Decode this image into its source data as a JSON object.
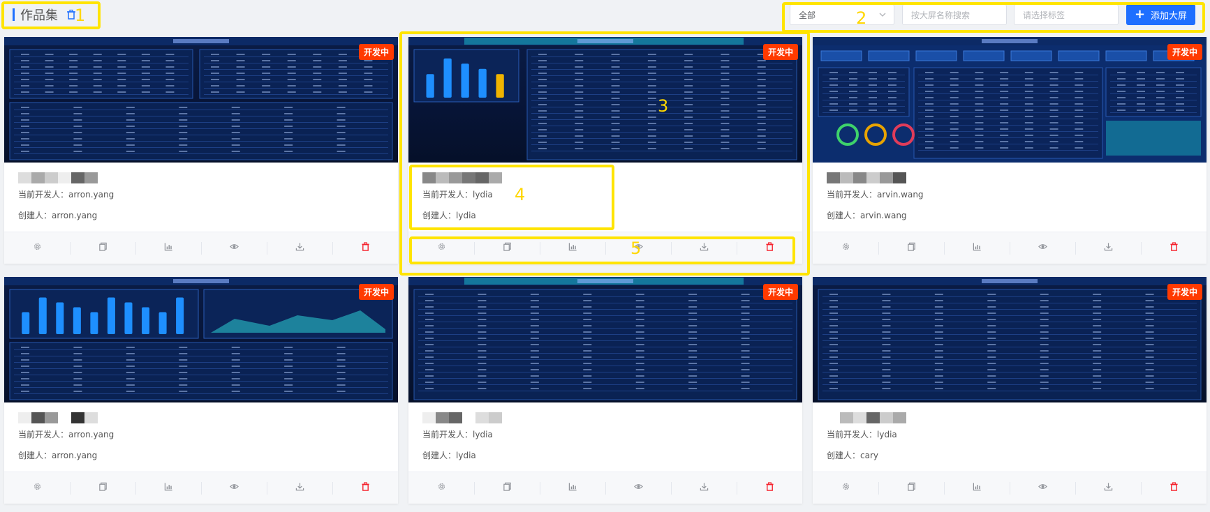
{
  "page": {
    "title": "作品集",
    "title_icon": "trash-icon"
  },
  "toolbar": {
    "category_select": "全部",
    "search_placeholder": "按大屏名称搜索",
    "tag_placeholder": "请选择标签",
    "add_label": "添加大屏",
    "accent_color": "#1e6fff"
  },
  "labels": {
    "developer_prefix": "当前开发人：",
    "creator_prefix": "创建人：",
    "status_badge": "开发中",
    "badge_color": "#ff3a00"
  },
  "cards": [
    {
      "preview_title": "知识库情况",
      "developer": "arron.yang",
      "creator": "arron.yang",
      "status": "开发中"
    },
    {
      "preview_title": "话务倒重复受理事件",
      "developer": "lydia",
      "creator": "lydia",
      "status": "开发中"
    },
    {
      "preview_title": "中国航油运维管理大屏",
      "developer": "arvin.wang",
      "creator": "arvin.wang",
      "status": "开发中"
    },
    {
      "preview_title": "受理情况",
      "developer": "arron.yang",
      "creator": "arron.yang",
      "status": "开发中"
    },
    {
      "preview_title": "重点关注事件",
      "developer": "lydia",
      "creator": "lydia",
      "status": "开发中"
    },
    {
      "preview_title": "升级信息",
      "developer": "lydia",
      "creator": "cary",
      "status": "开发中"
    }
  ],
  "card_actions": [
    {
      "name": "settings-button",
      "icon": "gear-icon"
    },
    {
      "name": "copy-button",
      "icon": "copy-icon"
    },
    {
      "name": "chart-button",
      "icon": "chart-icon"
    },
    {
      "name": "preview-button",
      "icon": "eye-icon"
    },
    {
      "name": "download-button",
      "icon": "download-icon"
    },
    {
      "name": "delete-button",
      "icon": "trash-icon"
    }
  ],
  "annotations": [
    "1",
    "2",
    "3",
    "4",
    "5"
  ]
}
